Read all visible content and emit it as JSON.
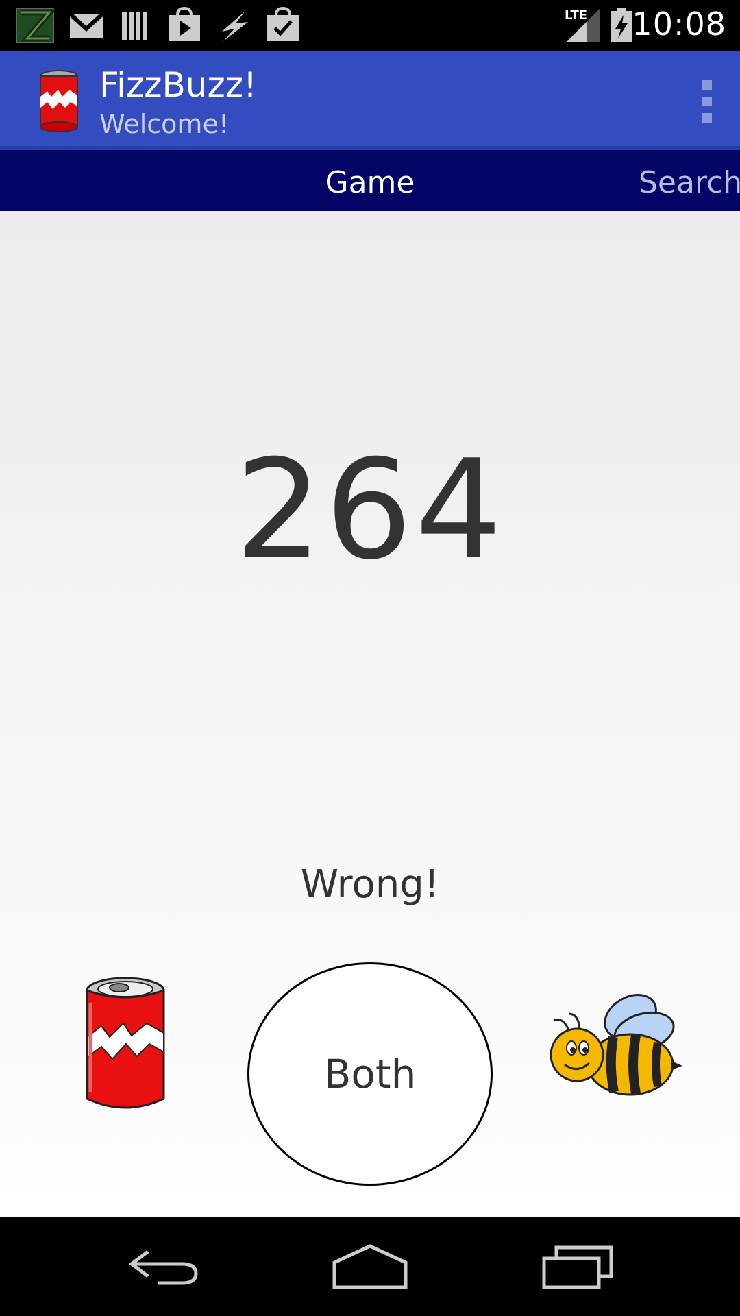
{
  "status_bar": {
    "time": "10:08",
    "network": "LTE",
    "icons": [
      "app-z-icon",
      "gmail-icon",
      "library-icon",
      "play-store-icon",
      "flash-icon",
      "shopping-check-icon",
      "signal-icon",
      "battery-charging-icon"
    ]
  },
  "action_bar": {
    "title": "FizzBuzz!",
    "subtitle": "Welcome!",
    "app_icon": "soda-can-icon",
    "menu_icon": "overflow-menu-icon",
    "color": "#334cbf"
  },
  "tabs": [
    {
      "label": "Game",
      "selected": true
    },
    {
      "label": "Search",
      "selected": false
    }
  ],
  "game": {
    "number": "264",
    "message": "Wrong!",
    "buttons": {
      "fizz_icon": "soda-can-icon",
      "both_label": "Both",
      "buzz_icon": "bee-icon"
    }
  },
  "nav_bar": {
    "icons": [
      "back-icon",
      "home-icon",
      "recents-icon"
    ]
  }
}
